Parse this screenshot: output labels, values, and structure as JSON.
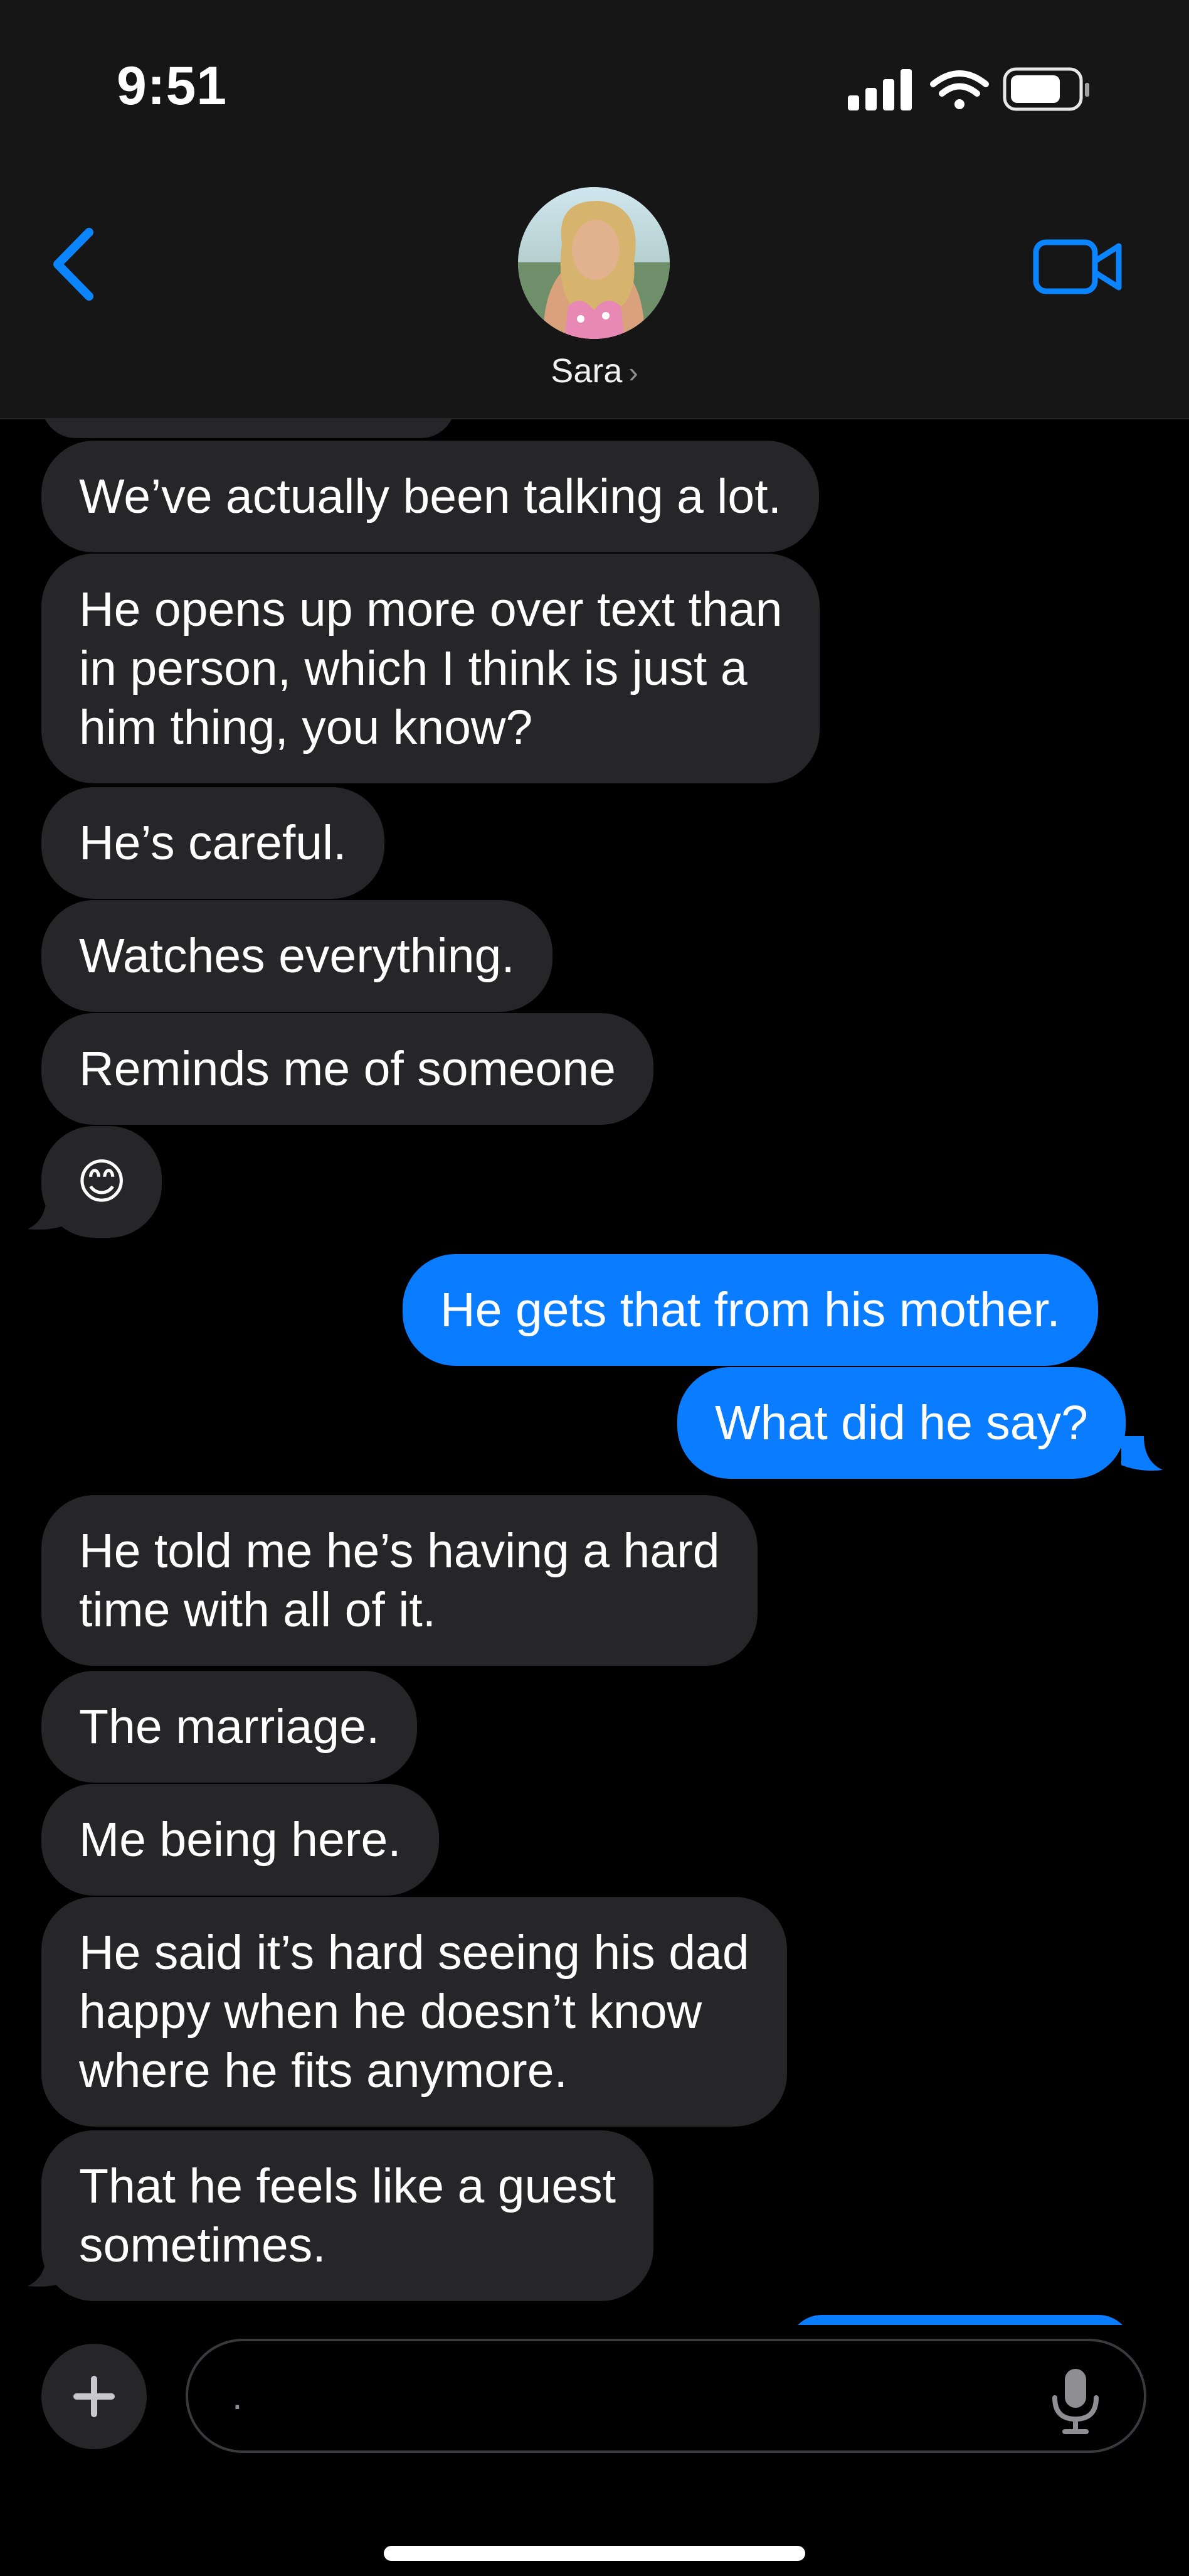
{
  "status_bar": {
    "time": "9:51"
  },
  "header": {
    "contact_name": "Sara",
    "name_chevron": "›"
  },
  "colors": {
    "sent_bubble": "#0a7cff",
    "received_bubble": "#262628",
    "accent": "#0a84ff"
  },
  "messages": [
    {
      "direction": "received",
      "text": "We’ve actually been talking a lot."
    },
    {
      "direction": "received",
      "lines": [
        "He opens up more over text than",
        "in person, which I think is just a",
        "him thing, you know?"
      ]
    },
    {
      "direction": "received",
      "text": "He’s careful."
    },
    {
      "direction": "received",
      "text": "Watches everything."
    },
    {
      "direction": "received",
      "text": "Reminds me of someone"
    },
    {
      "direction": "received",
      "text": "😊"
    },
    {
      "direction": "sent",
      "text": "He gets that from his mother."
    },
    {
      "direction": "sent",
      "text": "What did he say?"
    },
    {
      "direction": "received",
      "lines": [
        "He told me he’s having a hard",
        "time with all of it."
      ]
    },
    {
      "direction": "received",
      "text": "The marriage."
    },
    {
      "direction": "received",
      "text": "Me being here."
    },
    {
      "direction": "received",
      "lines": [
        "He said it’s hard seeing his dad",
        "happy when he doesn’t know",
        "where he fits anymore."
      ]
    },
    {
      "direction": "received",
      "lines": [
        "That he feels like a guest",
        "sometimes."
      ]
    }
  ],
  "composer": {
    "input_value": "."
  },
  "icons": {
    "back": "chevron-left-icon",
    "video": "video-camera-icon",
    "plus": "plus-icon",
    "mic": "microphone-icon",
    "signal": "cellular-signal-icon",
    "wifi": "wifi-icon",
    "battery": "battery-icon"
  }
}
